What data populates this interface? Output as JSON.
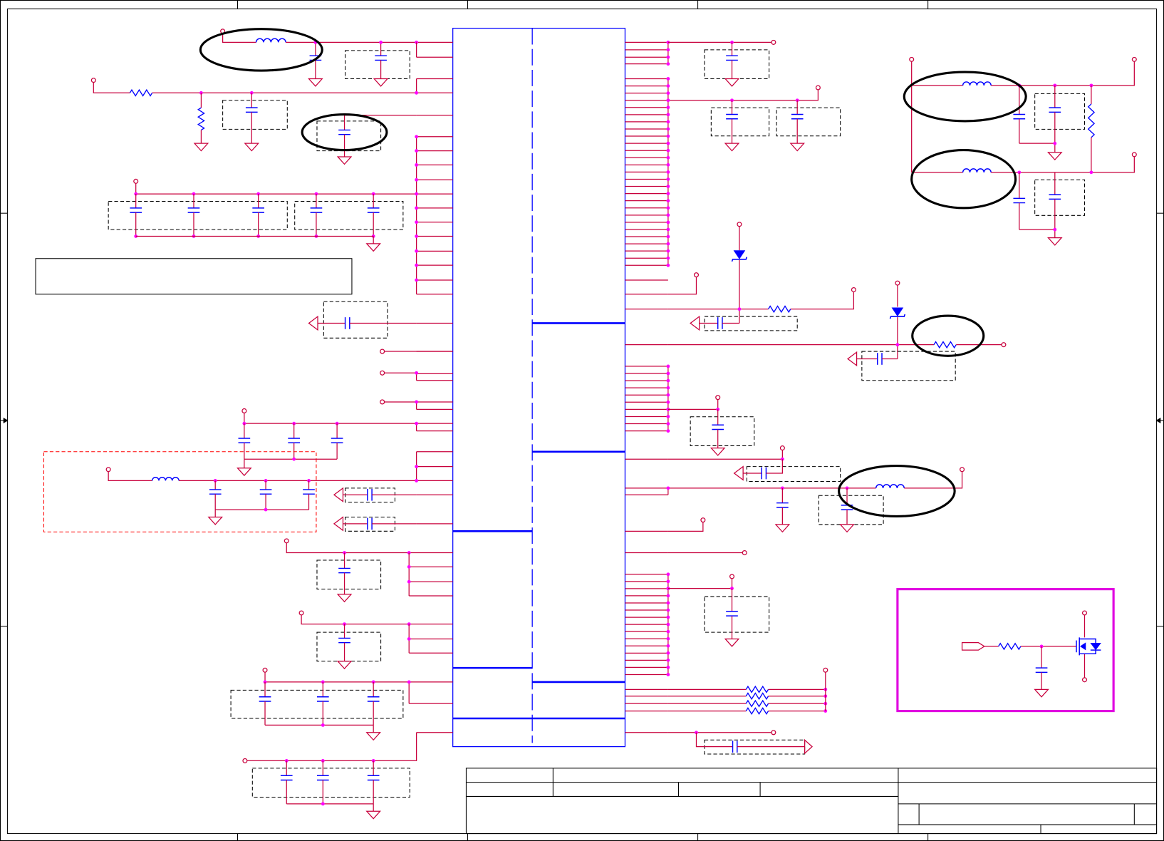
{
  "colors": {
    "background": "#ffffff",
    "wire": "#c8003c",
    "component": "#0000ff",
    "ic_outline": "#0000ff",
    "junction": "#ff00ff",
    "port_fill": "#ffffff",
    "highlight_ring": "#000000",
    "frame": "#000000",
    "group_box": "#000000",
    "filter_box": "#ff0000",
    "callout_box": "#e000e0"
  },
  "icons": [
    "inductor-icon",
    "capacitor-icon",
    "resistor-icon",
    "ground-icon",
    "zener-diode-icon",
    "mosfet-icon",
    "power-port-icon",
    "off-page-connector-icon"
  ]
}
